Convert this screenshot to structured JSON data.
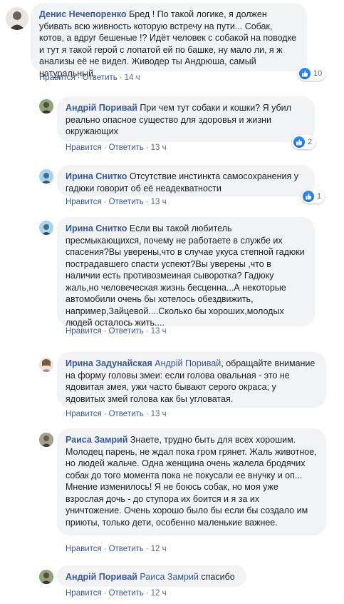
{
  "labels": {
    "like": "Нравится",
    "reply": "Ответить"
  },
  "comments": [
    {
      "author": "Денис Нечепоренко",
      "text": "Бред ! По такой логике, я должен убивать всю живность которую встречу на пути... Собак, котов, а вдруг бешеные !? Идёт человек с собакой на поводке и тут я такой герой с лопатой ей по башке, ну мало ли, я ж анализы её не видел. Живодер ты Андрюша, самый натуральный.",
      "time": "14 ч",
      "reactions": "10"
    },
    {
      "author": "Андрій Поривай",
      "text": "При чем тут собаки и кошки? Я убил реально опасное существо для здоровья и жизни окружающих",
      "time": "13 ч",
      "reactions": "2"
    },
    {
      "author": "Ирина Снитко",
      "text": "Отсутствие инстинкта самосохранения у гадюки говорит об её неадекватности",
      "time": "13 ч",
      "reactions": "1"
    },
    {
      "author": "Ирина Снитко",
      "text": "Если вы такой любитель пресмыкающихся, почему не работаете в службе их спасения?Вы уверены,что в случае укуса степной гадюки пострадавшего спасти успеют?Вы уверены ,что в наличии есть противозмеиная сыворотка? Гадюку жаль,но человеческая жизнь бесценна...А некоторые автомобили очень бы хотелось обездвижить, например,Зайцевой....Сколько бы хороших,молодых людей осталось жить....",
      "time": "13 ч"
    },
    {
      "author": "Ирина Задунайская",
      "mention": "Андрій Поривай",
      "text": ", обращайте внимание на форму головы змеи: если голова овальная - это не ядовитая змея, ужи часто бывают серого окраса; у ядовитых змей голова как бы угловатая.",
      "time": "13 ч"
    },
    {
      "author": "Раиса Замрий",
      "text": "Знаете, трудно быть для всех хорошим. Молодец парень, не ждал пока гром грянет. Жаль животное, но людей жальче. Одна женщина очень жалела бродячих собак до того момента пока не покусали ее внучку и оп... Мнение изменилось! Я не боюсь собак, но моя уже взрослая дочь - до ступора их боится и я за их уничтожение. Очень хорошо было бы если бы создало им приюты, только дети, особенно маленькие важнее.",
      "time": "12 ч"
    },
    {
      "author": "Андрій Поривай",
      "mention": "Раиса Замрий",
      "text": "спасибо",
      "time": "12 ч"
    }
  ],
  "colors": {
    "link": "#385898",
    "bubble": "#f2f3f5",
    "meta": "#606770",
    "like_blue": "#1a6ee8"
  },
  "icons": {
    "reaction": "like-icon"
  }
}
